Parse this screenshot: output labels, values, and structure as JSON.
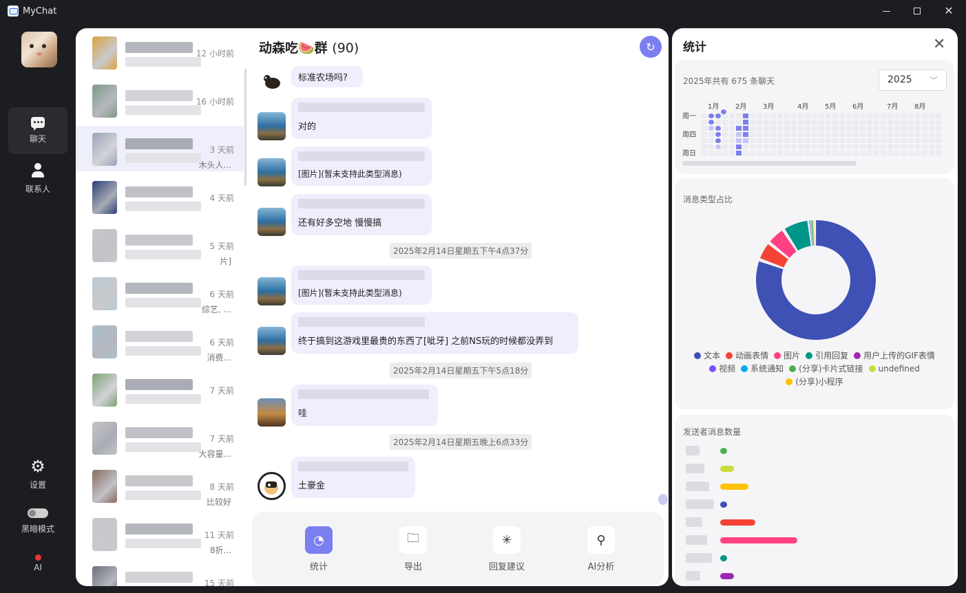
{
  "window": {
    "title": "MyChat"
  },
  "nav": {
    "chat_label": "聊天",
    "contacts_label": "联系人",
    "settings_label": "设置",
    "dark_mode_label": "黑暗模式",
    "ai_label": "AI"
  },
  "sessions": [
    {
      "time": "12 小时前",
      "preview": "",
      "avatar_color": "#d9a23b",
      "active": false
    },
    {
      "time": "16 小时前",
      "preview": "",
      "avatar_color": "#7e9a86",
      "active": false
    },
    {
      "time": "3 天前",
      "preview": "木头人...",
      "avatar_color": "#9aa3b8",
      "active": true
    },
    {
      "time": "4 天前",
      "preview": "",
      "avatar_color": "#2b3f77",
      "active": false
    },
    {
      "time": "5 天前",
      "preview": "片]",
      "avatar_color": "#c8c8cc",
      "active": false
    },
    {
      "time": "6 天前",
      "preview": "综艺, ...",
      "avatar_color": "#b9c9d3",
      "active": false
    },
    {
      "time": "6 天前",
      "preview": "消费...",
      "avatar_color": "#a9bfce",
      "active": false
    },
    {
      "time": "7 天前",
      "preview": "",
      "avatar_color": "#7aa270",
      "active": false
    },
    {
      "time": "7 天前",
      "preview": "大容量...",
      "avatar_color": "#c5c5c8",
      "active": false
    },
    {
      "time": "8 天前",
      "preview": "比较好",
      "avatar_color": "#8a6a5e",
      "active": false
    },
    {
      "time": "11 天前",
      "preview": "8折...",
      "avatar_color": "#c8c8cb",
      "active": false
    },
    {
      "time": "15 天前",
      "preview": "",
      "avatar_color": "#6c6f7a",
      "active": false
    }
  ],
  "chat": {
    "title": "动森吃🍉群",
    "member_count": "(90)",
    "messages": [
      {
        "type": "text",
        "text": "标准农场吗?"
      },
      {
        "type": "text",
        "text": "对的"
      },
      {
        "type": "text",
        "text": "[图片](暂未支持此类型消息)"
      },
      {
        "type": "text",
        "text": "还有好多空地 慢慢搞"
      },
      {
        "type": "time",
        "text": "2025年2月14日星期五下午4点37分"
      },
      {
        "type": "text",
        "text": "[图片](暂未支持此类型消息)"
      },
      {
        "type": "text",
        "text": "终于搞到这游戏里最贵的东西了[呲牙] 之前NS玩的时候都没弄到"
      },
      {
        "type": "time",
        "text": "2025年2月14日星期五下午5点18分"
      },
      {
        "type": "text",
        "text": "哇"
      },
      {
        "type": "time",
        "text": "2025年2月14日星期五晚上6点33分"
      },
      {
        "type": "text",
        "text": "土豪金"
      }
    ],
    "footer": {
      "stats_label": "统计",
      "export_label": "导出",
      "reply_suggest_label": "回复建议",
      "ai_analysis_label": "AI分析"
    }
  },
  "stats": {
    "title": "统计",
    "heatmap": {
      "summary": "2025年共有 675 条聊天",
      "year": "2025",
      "months": [
        "1月",
        "2月",
        "3月",
        "4月",
        "5月",
        "6月",
        "7月",
        "8月"
      ],
      "days": [
        "周一",
        "周四",
        "周日"
      ]
    },
    "pie": {
      "title": "消息类型占比",
      "legend": [
        {
          "name": "文本",
          "color": "#3f51b5"
        },
        {
          "name": "动画表情",
          "color": "#f44336"
        },
        {
          "name": "图片",
          "color": "#ff4081"
        },
        {
          "name": "引用回复",
          "color": "#009688"
        },
        {
          "name": "用户上传的GIF表情",
          "color": "#9c27b0"
        },
        {
          "name": "视频",
          "color": "#7c4dff"
        },
        {
          "name": "系统通知",
          "color": "#03a9f4"
        },
        {
          "name": "(分享)卡片式链接",
          "color": "#4caf50"
        },
        {
          "name": "undefined",
          "color": "#cddc39"
        },
        {
          "name": "(分享)小程序",
          "color": "#ffc107"
        }
      ]
    },
    "senders": {
      "title": "发送者消息数量",
      "bars": [
        {
          "color": "#4caf50",
          "value": 1
        },
        {
          "color": "#cddc39",
          "value": 2
        },
        {
          "color": "#ffc107",
          "value": 4
        },
        {
          "color": "#3f51b5",
          "value": 1
        },
        {
          "color": "#f44336",
          "value": 5
        },
        {
          "color": "#ff4081",
          "value": 11
        },
        {
          "color": "#009688",
          "value": 1
        },
        {
          "color": "#9c27b0",
          "value": 2
        }
      ]
    }
  },
  "chart_data": {
    "type": "pie",
    "title": "消息类型占比",
    "categories": [
      "文本",
      "动画表情",
      "图片",
      "引用回复",
      "用户上传的GIF表情",
      "视频",
      "系统通知",
      "(分享)卡片式链接",
      "undefined",
      "(分享)小程序"
    ],
    "values": [
      78,
      5,
      5,
      7,
      0.2,
      0.2,
      0.2,
      0.4,
      0.2,
      0.2
    ]
  }
}
